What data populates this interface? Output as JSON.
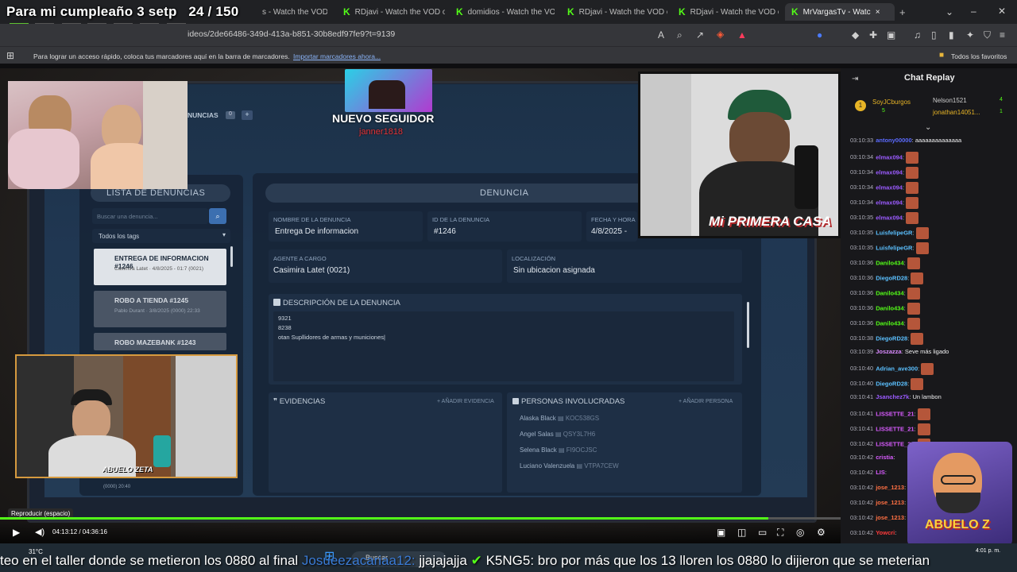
{
  "overlay": {
    "title": "Para mi cumpleaño 3 setp",
    "counter": "24 / 150"
  },
  "tabs": [
    {
      "label": "s - Watch the VOD"
    },
    {
      "label": "RDjavi - Watch the VOD o"
    },
    {
      "label": "domidios - Watch the VOD"
    },
    {
      "label": "RDjavi - Watch the VOD o"
    },
    {
      "label": "RDjavi - Watch the VOD o"
    },
    {
      "label": "MrVargasTv - Watc"
    }
  ],
  "tab_close": "×",
  "tab_new": "+",
  "address": {
    "url": "ideos/2de66486-349d-413a-b851-30b8edf97fe9?t=9139"
  },
  "bookmarks": {
    "text": "Para lograr un acceso rápido, coloca tus marcadores aquí en la barra de marcadores.",
    "link": "Importar marcadores ahora...",
    "all": "Todos los favoritos"
  },
  "app": {
    "follower_banner": "NUEVO SEGUIDOR",
    "follower_name": "janner1818",
    "tab_denuncias": "NUNCIAS",
    "tab_badge": "0",
    "list_title": "LISTA DE DENUNCIAS",
    "search_placeholder": "Buscar una denuncia...",
    "tags_select": "Todos los tags",
    "list": [
      {
        "title": "ENTREGA DE INFORMACION #1246",
        "sub": "Casimira Latet · 4/8/2025 - 01:7 (0021)"
      },
      {
        "title": "ROBO A TIENDA #1245",
        "sub": "Pablo Durant · 3/8/2025 (0000) 22:33"
      },
      {
        "title": "ROBO MAZEBANK #1243",
        "sub": ""
      }
    ],
    "list_footer": "(0000) 20:40",
    "detail_title": "DENUNCIA",
    "fields": {
      "name_label": "NOMBRE DE LA DENUNCIA",
      "name_value": "Entrega De informacion",
      "id_label": "ID DE LA DENUNCIA",
      "id_value": "#1246",
      "date_label": "FECHA Y HORA",
      "date_value": "4/8/2025 -",
      "agent_label": "AGENTE A CARGO",
      "agent_value": "Casimira Latet (0021)",
      "loc_label": "LOCALIZACIÓN",
      "loc_value": "Sin ubicacion asignada"
    },
    "description_label": "DESCRIPCIÓN DE LA DENUNCIA",
    "description_lines": [
      "9321",
      "8238",
      "otan Supllidores de armas y municiones|"
    ],
    "evidence_label": "EVIDENCIAS",
    "add_evidence": "+ AÑADIR EVIDENCIA",
    "people_label": "PERSONAS INVOLUCRADAS",
    "add_person": "+ AÑADIR PERSONA",
    "people": [
      {
        "name": "Alaska Black",
        "id": "KOC538GS"
      },
      {
        "name": "Angel Salas",
        "id": "QSY3L7H6"
      },
      {
        "name": "Selena Black",
        "id": "FI9OCJSC"
      },
      {
        "name": "Luciano Valenzuela",
        "id": "VTPA7CEW"
      }
    ]
  },
  "cams": {
    "casa_text": "Mi PRIMERA CASA",
    "abuelo_label": "ABUELO ZETA",
    "logo_text": "ABUELO Z"
  },
  "chat": {
    "title": "Chat Replay",
    "top": [
      {
        "name": "SoyJCburgos",
        "count": "5"
      },
      {
        "name": "Nelson1521",
        "count": "4"
      },
      {
        "name": "jonathan14051...",
        "count": "1"
      }
    ],
    "messages": [
      {
        "t": "03:10:33",
        "u": "antony00000",
        "m": "aaaaaaaaaaaaaa",
        "c": "#5b6bff",
        "emote": false
      },
      {
        "t": "03:10:34",
        "u": "elmax094",
        "m": "",
        "c": "#9b5bff",
        "emote": true
      },
      {
        "t": "03:10:34",
        "u": "elmax094",
        "m": "",
        "c": "#9b5bff",
        "emote": true
      },
      {
        "t": "03:10:34",
        "u": "elmax094",
        "m": "",
        "c": "#9b5bff",
        "emote": true
      },
      {
        "t": "03:10:34",
        "u": "elmax094",
        "m": "",
        "c": "#9b5bff",
        "emote": true
      },
      {
        "t": "03:10:35",
        "u": "elmax094",
        "m": "",
        "c": "#9b5bff",
        "emote": true
      },
      {
        "t": "03:10:35",
        "u": "LuisfelipeGR",
        "m": "",
        "c": "#5bc0ff",
        "emote": true
      },
      {
        "t": "03:10:35",
        "u": "LuisfelipeGR",
        "m": "",
        "c": "#5bc0ff",
        "emote": true
      },
      {
        "t": "03:10:36",
        "u": "Danilo434",
        "m": "",
        "c": "#53fc18",
        "emote": true
      },
      {
        "t": "03:10:36",
        "u": "DiegoRD28",
        "m": "",
        "c": "#5bc0ff",
        "emote": true
      },
      {
        "t": "03:10:36",
        "u": "Danilo434",
        "m": "",
        "c": "#53fc18",
        "emote": true
      },
      {
        "t": "03:10:36",
        "u": "Danilo434",
        "m": "",
        "c": "#53fc18",
        "emote": true
      },
      {
        "t": "03:10:36",
        "u": "Danilo434",
        "m": "",
        "c": "#53fc18",
        "emote": true
      },
      {
        "t": "03:10:38",
        "u": "DiegoRD28",
        "m": "",
        "c": "#5bc0ff",
        "emote": true
      },
      {
        "t": "03:10:39",
        "u": "Joszazza",
        "m": "Seve más ligado",
        "c": "#d98bff",
        "emote": false
      },
      {
        "t": "03:10:40",
        "u": "Adrian_ave300",
        "m": "",
        "c": "#5bc0ff",
        "emote": true
      },
      {
        "t": "03:10:40",
        "u": "DiegoRD28",
        "m": "",
        "c": "#5bc0ff",
        "emote": true
      },
      {
        "t": "03:10:41",
        "u": "Jsanchez7k",
        "m": "Un lambon",
        "c": "#9b5bff",
        "emote": false
      },
      {
        "t": "03:10:41",
        "u": "LISSETTE_21",
        "m": "",
        "c": "#d95bff",
        "emote": true
      },
      {
        "t": "03:10:41",
        "u": "LISSETTE_21",
        "m": "",
        "c": "#d95bff",
        "emote": true
      },
      {
        "t": "03:10:42",
        "u": "LISSETTE_21",
        "m": "",
        "c": "#d95bff",
        "emote": true
      },
      {
        "t": "03:10:42",
        "u": "cristia",
        "m": "",
        "c": "#d95bff",
        "emote": false
      },
      {
        "t": "03:10:42",
        "u": "LIS",
        "m": "",
        "c": "#d95bff",
        "emote": false
      },
      {
        "t": "03:10:42",
        "u": "jose_1213",
        "m": "",
        "c": "#ff7043",
        "emote": false
      },
      {
        "t": "03:10:42",
        "u": "jose_1213",
        "m": "",
        "c": "#ff7043",
        "emote": false
      },
      {
        "t": "03:10:42",
        "u": "jose_1213",
        "m": "",
        "c": "#ff7043",
        "emote": false
      },
      {
        "t": "03:10:42",
        "u": "Yowcri",
        "m": "",
        "c": "#ff3b3b",
        "emote": false
      }
    ]
  },
  "player": {
    "tooltip": "Reproducir (espacio)",
    "time": "04:13:12 / 04:36:16",
    "progress": 0.914
  },
  "taskbar": {
    "weather": "31°C",
    "search": "Buscar",
    "clock": "4:01 p. m."
  },
  "ticker": {
    "part1": "teo en el taller donde se metieron los 0880 al final",
    "user1": "Josueezacariaa12:",
    "part2": "jjajajajja",
    "user2": "K5NG5:",
    "part3": "bro por más que los 13 lloren los 0880 lo dijieron que se meterian"
  },
  "colors": {
    "kick_green": "#53fc18",
    "panel": "#172538",
    "chat_bg": "#18181b"
  }
}
